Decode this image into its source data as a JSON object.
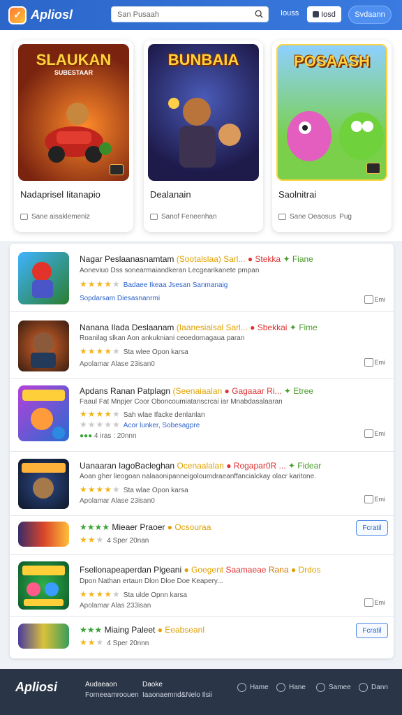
{
  "header": {
    "logo_glyph": "✓",
    "logo_text": "Apliosl",
    "search_placeholder": "San Pusaah",
    "nav_link": "Iouss",
    "nav_button": "Iosd",
    "cta_button": "Svdaann"
  },
  "featured": [
    {
      "art_title": "SLAUKAN",
      "art_sub": "SUBESTAAR",
      "title": "Nadaprisel Iitanapio",
      "meta": "Sane aisaklemeniz",
      "meta2": ""
    },
    {
      "art_title": "BUNBAIA",
      "art_sub": "",
      "title": "Dealanain",
      "meta": "Sanof Feneenhan",
      "meta2": ""
    },
    {
      "art_title": "POSAASH",
      "art_sub": "",
      "title": "Saolnitrai",
      "meta": "Sane Oeaosus",
      "meta2": "Pug"
    }
  ],
  "list": [
    {
      "name": "Nagar Peslaanasnamtam",
      "tag": "(Sootalslaa) Sarl...",
      "tag2": "Stekka",
      "tag3": "Fiane",
      "desc": "Aoneviuo Dss sonearmaiandkeran Lecgearikanete pmpan",
      "stars_text": "Badaee Ikeaa Jsesan Sanmanaig",
      "meta": "Sopdarsam Diesasnanrmi",
      "action": "Emi"
    },
    {
      "name": "Nanana Ilada Deslaanam",
      "tag": "(Iaanesialsal Sarl...",
      "tag2": "Sbekkai",
      "tag3": "Fime",
      "desc": "Roanilag slkan Aon ankukniani ceoedomagaua paran",
      "stars_text": "Sta wlee Opon karsa",
      "meta": "Apolamar Alase 23isan0",
      "action": "Emi"
    },
    {
      "name": "Apdans Ranan Patplagn",
      "tag": "(Seenaiaalan",
      "tag2": "Gagaaar Ri...",
      "tag3": "Etree",
      "desc": "Faaul Fat Mnpjer Coor Oboncoumiatanscrcai iar Mnabdasalaaran",
      "stars_text": "Sah wlae Ifacke denlanlan",
      "stars_text2": "Acor lunker, Sobesagpre",
      "meta": "4 iras : 20nnn",
      "action": "Emi"
    },
    {
      "name": "Uanaaran IagoBacleghan",
      "tag": "Ocenaalalan",
      "tag2": "Rogapar0R ...",
      "tag3": "Fidear",
      "desc": "Aoan gher lieogoan nalaaonipanneigoloumdraeanffancialckay olacr karitone.",
      "stars_text": "Sta wlae Opon karsa",
      "meta": "Apolamar Alase 23isan0",
      "action": "Emi"
    },
    {
      "name": "Mieaer Praoer",
      "tag": "Ocsouraa",
      "tag2": "",
      "tag3": "",
      "desc": "",
      "stars_text": "4 Sper 20nan",
      "meta": "",
      "action": "Fcratil"
    },
    {
      "name": "Fsellonapeaperdan Plgeani",
      "tag": "Goegent",
      "tag2": "Saamaeae",
      "tag3": "Drdos",
      "tag4": "Rana",
      "desc": "Dpon Nathan ertaun Dlon Dloe Doe Keapery...",
      "stars_text": "Sta ulde Opnn karsa",
      "meta": "Apolamar Alas 233isan",
      "action": "Emi"
    },
    {
      "name": "Miaing Paleet",
      "tag": "Eeabseanl",
      "tag2": "",
      "tag3": "",
      "desc": "",
      "stars_text": "4 Sper 20nnn",
      "meta": "",
      "action": "Fcratil"
    }
  ],
  "footer": {
    "logo": "Apliosi",
    "col1_head": "Audaeaon",
    "col1_item": "Forneeamroouen",
    "col2_head": "Daoke",
    "col2_item": "Iaaonaemnd&Nelo Ilsii",
    "social": [
      "Hame",
      "Hane",
      "Samee",
      "Dann"
    ]
  },
  "colors": {
    "accent": "#2c66c9",
    "star": "#f2b51b",
    "link": "#2e64c8",
    "footer": "#2a3547"
  }
}
